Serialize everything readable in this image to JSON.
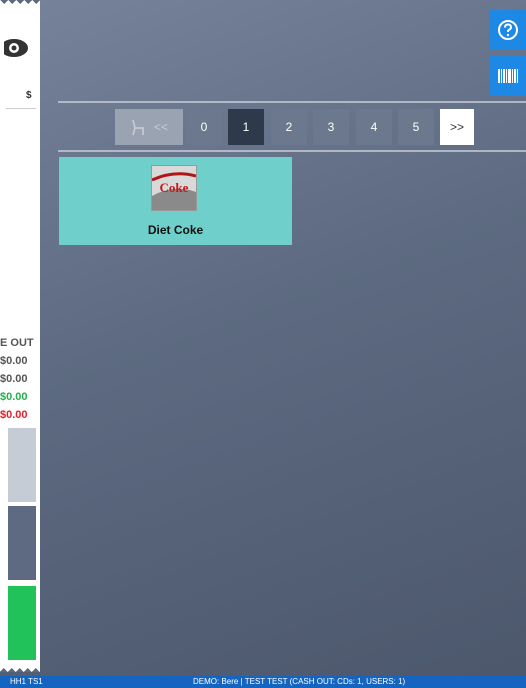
{
  "receipt": {
    "currency": "$",
    "totals_header": "E OUT",
    "totals": [
      "$0.00",
      "$0.00",
      "$0.00",
      "$0.00"
    ]
  },
  "pagination": {
    "prev_label": "<<",
    "pages": [
      "0",
      "1",
      "2",
      "3",
      "4",
      "5"
    ],
    "active_page": "1",
    "next_label": ">>"
  },
  "products": [
    {
      "name": "Diet Coke",
      "image_text": "Coke"
    }
  ],
  "statusbar": {
    "left_text": "HH1  TS1",
    "center_text": "DEMO: Bere | TEST TEST (CASH OUT: CDs: 1, USERS: 1)"
  },
  "colors": {
    "accent_blue": "#1e88e5",
    "tile_teal": "#6ecfcb",
    "positive_green": "#22b14c",
    "negative_red": "#e0202a"
  },
  "icons": [
    "eye-icon",
    "help-icon",
    "barcode-icon",
    "chair-icon"
  ]
}
